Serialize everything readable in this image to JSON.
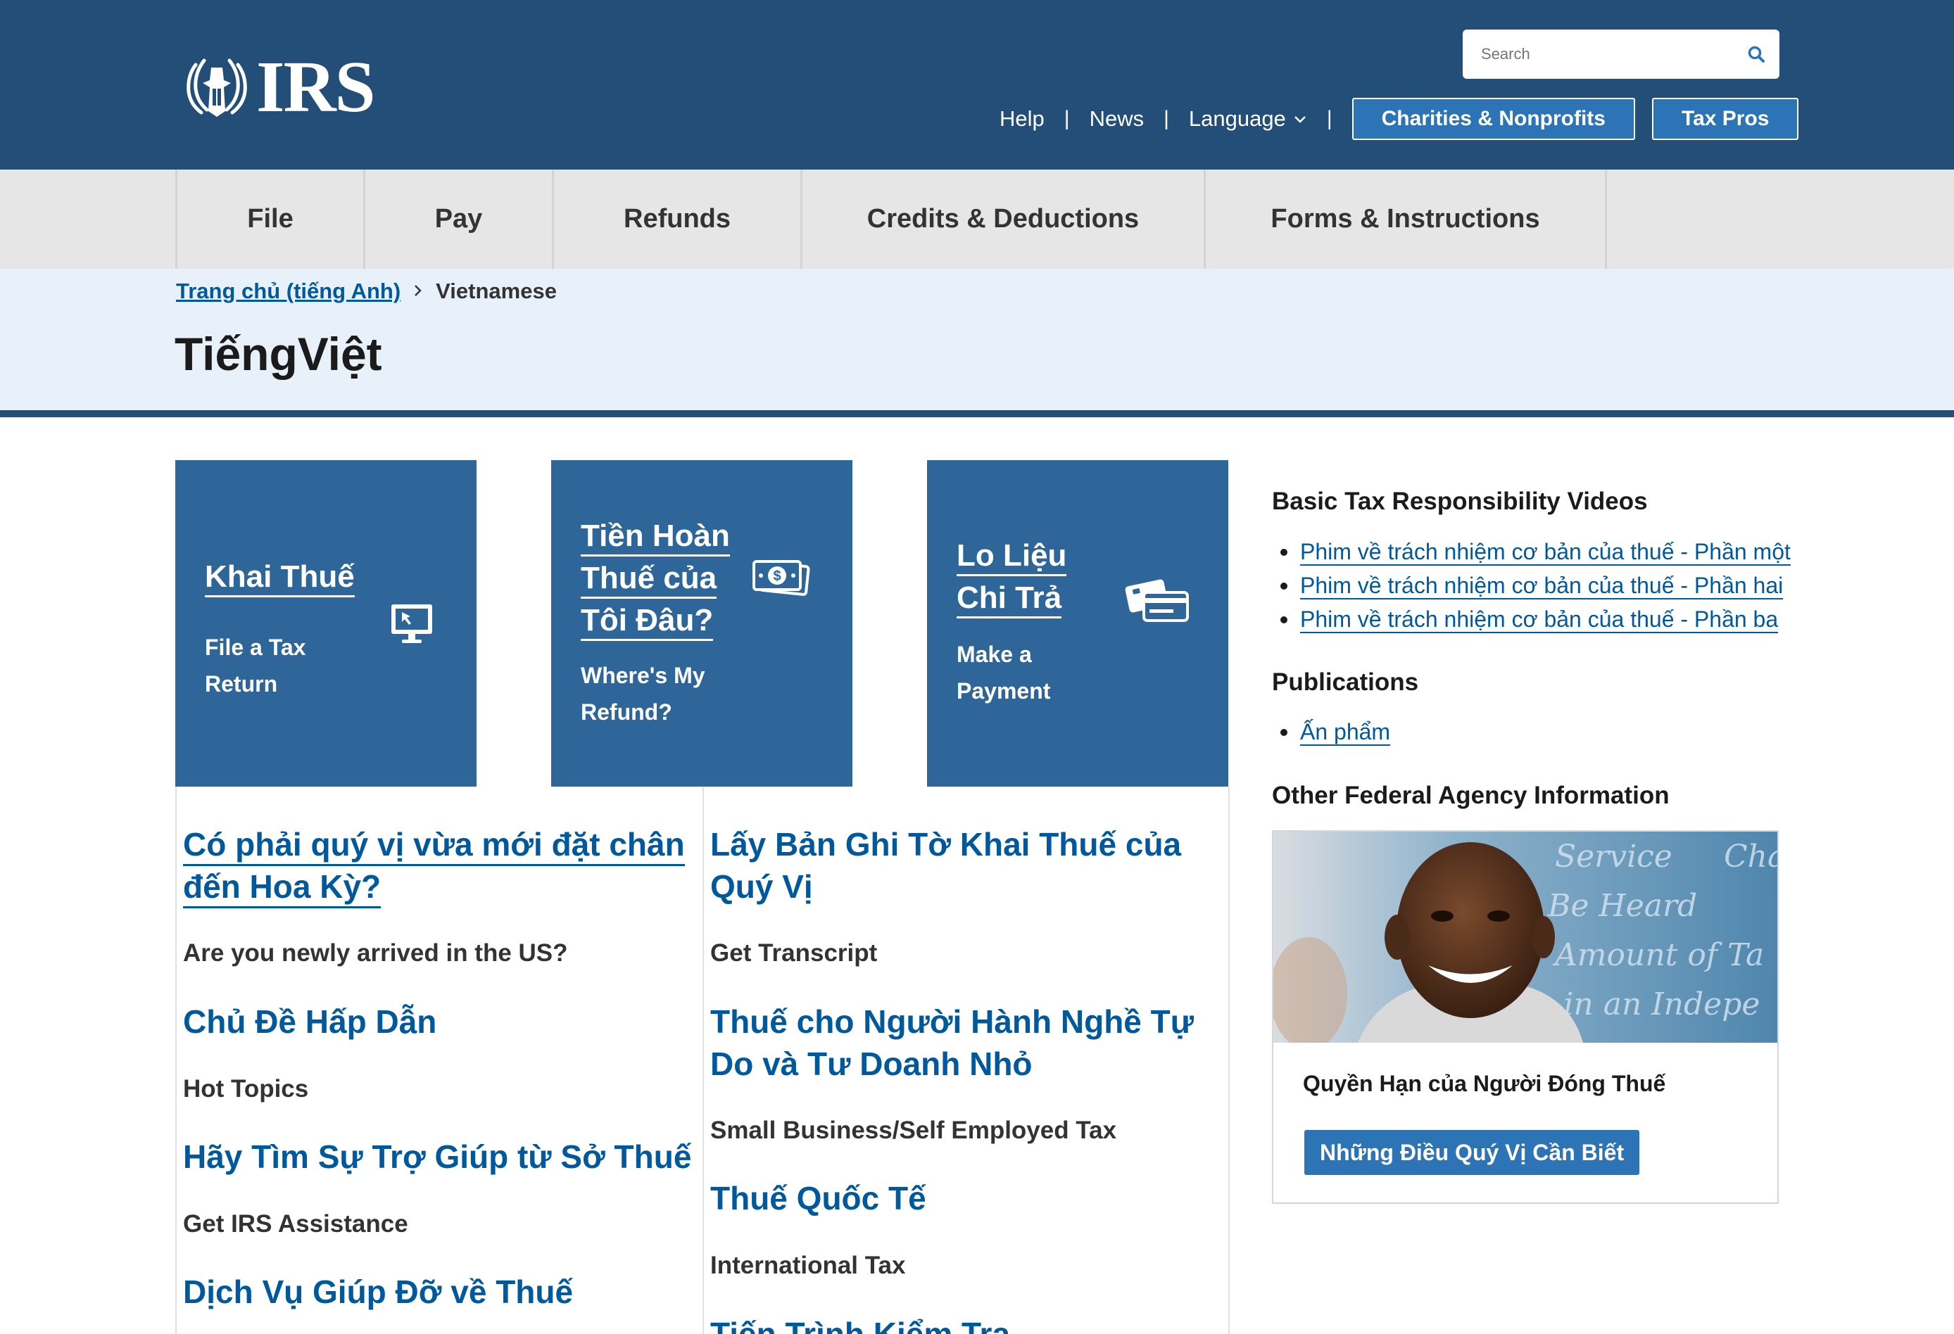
{
  "header": {
    "logo_text": "IRS",
    "search": {
      "placeholder": "Search"
    },
    "links": {
      "help": "Help",
      "news": "News",
      "language": "Language"
    },
    "buttons": {
      "charities": "Charities & Nonprofits",
      "tax_pros": "Tax Pros"
    },
    "icons": {
      "search": "search-icon",
      "chevron": "chevron-down-icon",
      "logo": "irs-eagle-icon"
    }
  },
  "nav": {
    "items": [
      {
        "label": "File"
      },
      {
        "label": "Pay"
      },
      {
        "label": "Refunds"
      },
      {
        "label": "Credits & Deductions"
      },
      {
        "label": "Forms & Instructions"
      }
    ]
  },
  "breadcrumb": {
    "home": "Trang chủ (tiếng Anh)",
    "current": "Vietnamese"
  },
  "page_title": "TiếngViệt",
  "tiles": [
    {
      "title_lines": [
        "Khai Thuế"
      ],
      "subtitle_lines": [
        "File a Tax",
        "Return"
      ],
      "icon": "computer-icon"
    },
    {
      "title_lines": [
        "Tiền Hoàn",
        "Thuế của",
        "Tôi Đâu?"
      ],
      "subtitle_lines": [
        "Where's My",
        "Refund?"
      ],
      "icon": "money-icon"
    },
    {
      "title_lines": [
        "Lo Liệu",
        "Chi Trả"
      ],
      "subtitle_lines": [
        "Make a",
        "Payment"
      ],
      "icon": "credit-card-icon"
    }
  ],
  "links_left": [
    {
      "title_lines": [
        "Có phải quý vị vừa mới đặt chân",
        "đến Hoa Kỳ?"
      ],
      "subtitle": "Are you newly arrived in the US?"
    },
    {
      "title_lines": [
        "Chủ Đề Hấp Dẫn"
      ],
      "subtitle": "Hot Topics"
    },
    {
      "title_lines": [
        "Hãy Tìm Sự Trợ Giúp từ Sở Thuế"
      ],
      "subtitle": "Get IRS Assistance"
    },
    {
      "title_lines": [
        "Dịch Vụ Giúp Đỡ về Thuế"
      ],
      "subtitle": ""
    }
  ],
  "links_right": [
    {
      "title_lines": [
        "Lấy Bản Ghi Tờ Khai Thuế của",
        "Quý Vị"
      ],
      "subtitle": "Get Transcript"
    },
    {
      "title_lines": [
        "Thuế cho Người Hành Nghề Tự",
        "Do và Tư Doanh Nhỏ"
      ],
      "subtitle": "Small Business/Self Employed Tax"
    },
    {
      "title_lines": [
        "Thuế Quốc Tế"
      ],
      "subtitle": "International Tax"
    },
    {
      "title_lines": [
        "Tiến Trình Kiểm Tra"
      ],
      "subtitle": ""
    }
  ],
  "sidebar": {
    "videos": {
      "heading": "Basic Tax Responsibility Videos",
      "items": [
        "Phim về trách nhiệm cơ bản của thuế - Phần một",
        "Phim về trách nhiệm cơ bản của thuế - Phần hai",
        "Phim về trách nhiệm cơ bản của thuế - Phần ba"
      ]
    },
    "publications": {
      "heading": "Publications",
      "items": [
        "Ấn phẩm"
      ]
    },
    "agency": {
      "heading": "Other Federal Agency Information",
      "card_text": "Quyền Hạn của Người Đóng Thuế",
      "card_button": "Những Điều Quý Vị Cần Biết",
      "image_words": [
        "Service",
        "Be Heard",
        "Amount of Ta",
        "n in an Indepe",
        "Cha"
      ]
    }
  },
  "colors": {
    "header_bg": "#234e77",
    "tile_bg": "#2e6699",
    "link": "#00599c",
    "button": "#2c74b5",
    "nav_bg": "#e6e6e6",
    "band_bg": "#e8f1f9"
  }
}
